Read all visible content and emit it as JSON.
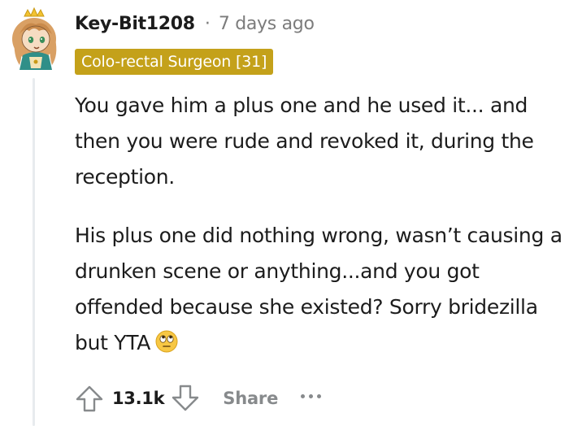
{
  "comment": {
    "username": "Key-Bit1208",
    "separator": "·",
    "timestamp": "7 days ago",
    "flair": "Colo-rectal Surgeon [31]",
    "paragraphs": [
      "You gave him a plus one and he used it... and then you were rude and revoked it, during the reception.",
      "His plus one did nothing wrong, wasn’t causing a drunken scene or anything...and you got offended because she existed? Sorry bridezilla but YTA"
    ],
    "emoji": "face-with-rolling-eyes"
  },
  "actions": {
    "upvote_icon": "upvote-arrow-icon",
    "score": "13.1k",
    "downvote_icon": "downvote-arrow-icon",
    "share_label": "Share",
    "more_icon": "more-options-icon"
  },
  "colors": {
    "flair_bg": "#c4a11a",
    "text": "#1c1c1c",
    "muted": "#7c7c7c",
    "action_muted": "#878a8c",
    "thread_line": "#e8ebee"
  }
}
